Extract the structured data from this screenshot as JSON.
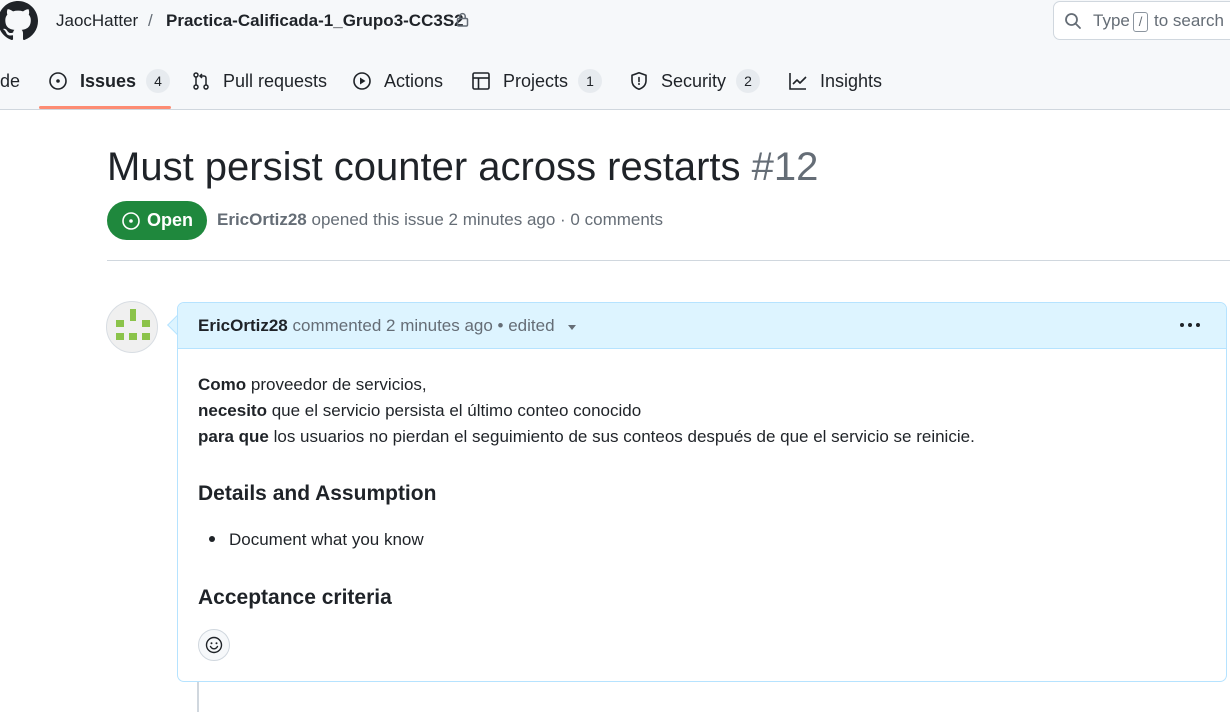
{
  "header": {
    "owner": "JaocHatter",
    "separator": "/",
    "repo": "Practica-Calificada-1_Grupo3-CC3S2",
    "search_prefix": "Type",
    "search_key": "/",
    "search_suffix": "to search"
  },
  "tabs": [
    {
      "label": "de"
    },
    {
      "label": "Issues",
      "count": "4"
    },
    {
      "label": "Pull requests"
    },
    {
      "label": "Actions"
    },
    {
      "label": "Projects",
      "count": "1"
    },
    {
      "label": "Security",
      "count": "2"
    },
    {
      "label": "Insights"
    }
  ],
  "issue": {
    "title": "Must persist counter across restarts",
    "number": "#12",
    "state": "Open",
    "author": "EricOrtiz28",
    "meta": "opened this issue 2 minutes ago · 0 comments"
  },
  "comment": {
    "author": "EricOrtiz28",
    "header_text": "commented 2 minutes ago • edited",
    "lines": [
      {
        "bold": "Como",
        "text": "proveedor de servicios,"
      },
      {
        "bold": "necesito",
        "text": "que el servicio persista el último conteo conocido"
      },
      {
        "bold": "para que",
        "text": "los usuarios no pierdan el seguimiento de sus conteos después de que el servicio se reinicie."
      }
    ],
    "heading_details": "Details and Assumption",
    "bullet": "Document what you know",
    "heading_acceptance": "Acceptance criteria"
  },
  "colors": {
    "open_green": "#1f883d",
    "tab_underline": "#fd8c73",
    "comment_header_bg": "#ddf4ff"
  },
  "icons": [
    "github-logo-icon",
    "lock-icon",
    "search-icon",
    "issue-opened-icon",
    "git-pull-request-icon",
    "play-icon",
    "table-icon",
    "shield-icon",
    "graph-icon",
    "caret-down-icon",
    "kebab-horizontal-icon",
    "smiley-icon"
  ]
}
